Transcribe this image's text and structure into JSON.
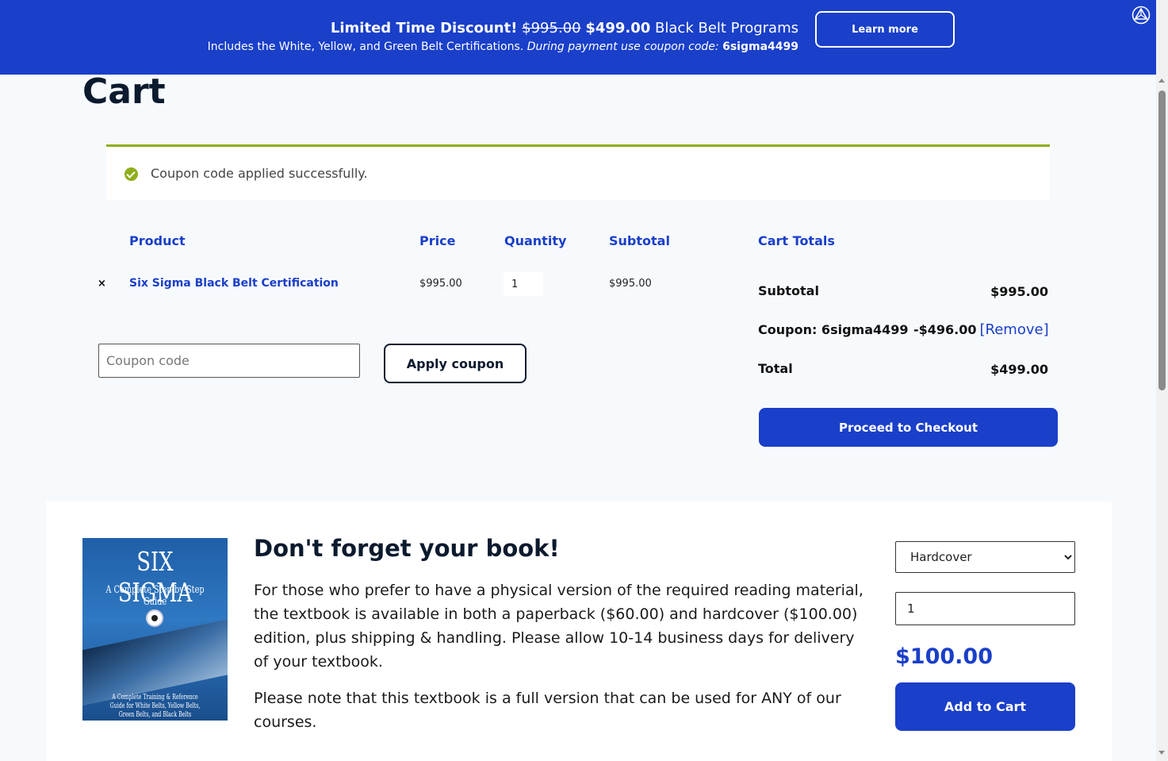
{
  "banner": {
    "headline_bold": "Limited Time Discount!",
    "old_price": "$995.00",
    "new_price": "$499.00",
    "program": "Black Belt Programs",
    "includes": "Includes the White, Yellow, and Green Belt Certifications.",
    "payment_note": "During payment use coupon code:",
    "coupon_code": "6sigma4499",
    "learn_more_label": "Learn more"
  },
  "page": {
    "title": "Cart"
  },
  "notice": {
    "message": "Coupon code applied successfully."
  },
  "cart_table": {
    "headers": {
      "product": "Product",
      "price": "Price",
      "quantity": "Quantity",
      "subtotal": "Subtotal"
    },
    "rows": [
      {
        "remove": "×",
        "product": "Six Sigma Black Belt Certification",
        "price": "$995.00",
        "quantity": "1",
        "subtotal": "$995.00"
      }
    ],
    "coupon_placeholder": "Coupon code",
    "apply_label": "Apply coupon"
  },
  "totals": {
    "title": "Cart Totals",
    "subtotal_label": "Subtotal",
    "subtotal_value": "$995.00",
    "coupon_label": "Coupon: 6sigma4499",
    "coupon_value": "-$496.00",
    "remove_label": "[Remove]",
    "total_label": "Total",
    "total_value": "$499.00",
    "checkout_label": "Proceed to Checkout"
  },
  "book": {
    "cover_title": "SIX SIGMA",
    "cover_subtitle": "A Complete Step-by-Step Guide",
    "cover_footer": "A Complete Training & Reference Guide for White Belts, Yellow Belts, Green Belts, and Black Belts",
    "heading": "Don't forget your book!",
    "paragraph1": "For those who prefer to have a physical version of the required reading material, the textbook is available in both a paperback ($60.00) and hardcover ($100.00) edition, plus shipping & handling. Please allow 10-14 business days for delivery of your textbook.",
    "paragraph2": "Please note that this textbook is a full version that can be used for ANY of our courses.",
    "format_selected": "Hardcover",
    "quantity": "1",
    "price": "$100.00",
    "add_to_cart_label": "Add to Cart"
  },
  "colors": {
    "brand_blue": "#1a3fc9",
    "success_green": "#8fae1b",
    "dark_navy": "#0c1a2e"
  },
  "icons": {
    "corner": "triangle-logo-icon",
    "notice": "check-circle-icon",
    "remove": "close-icon"
  }
}
